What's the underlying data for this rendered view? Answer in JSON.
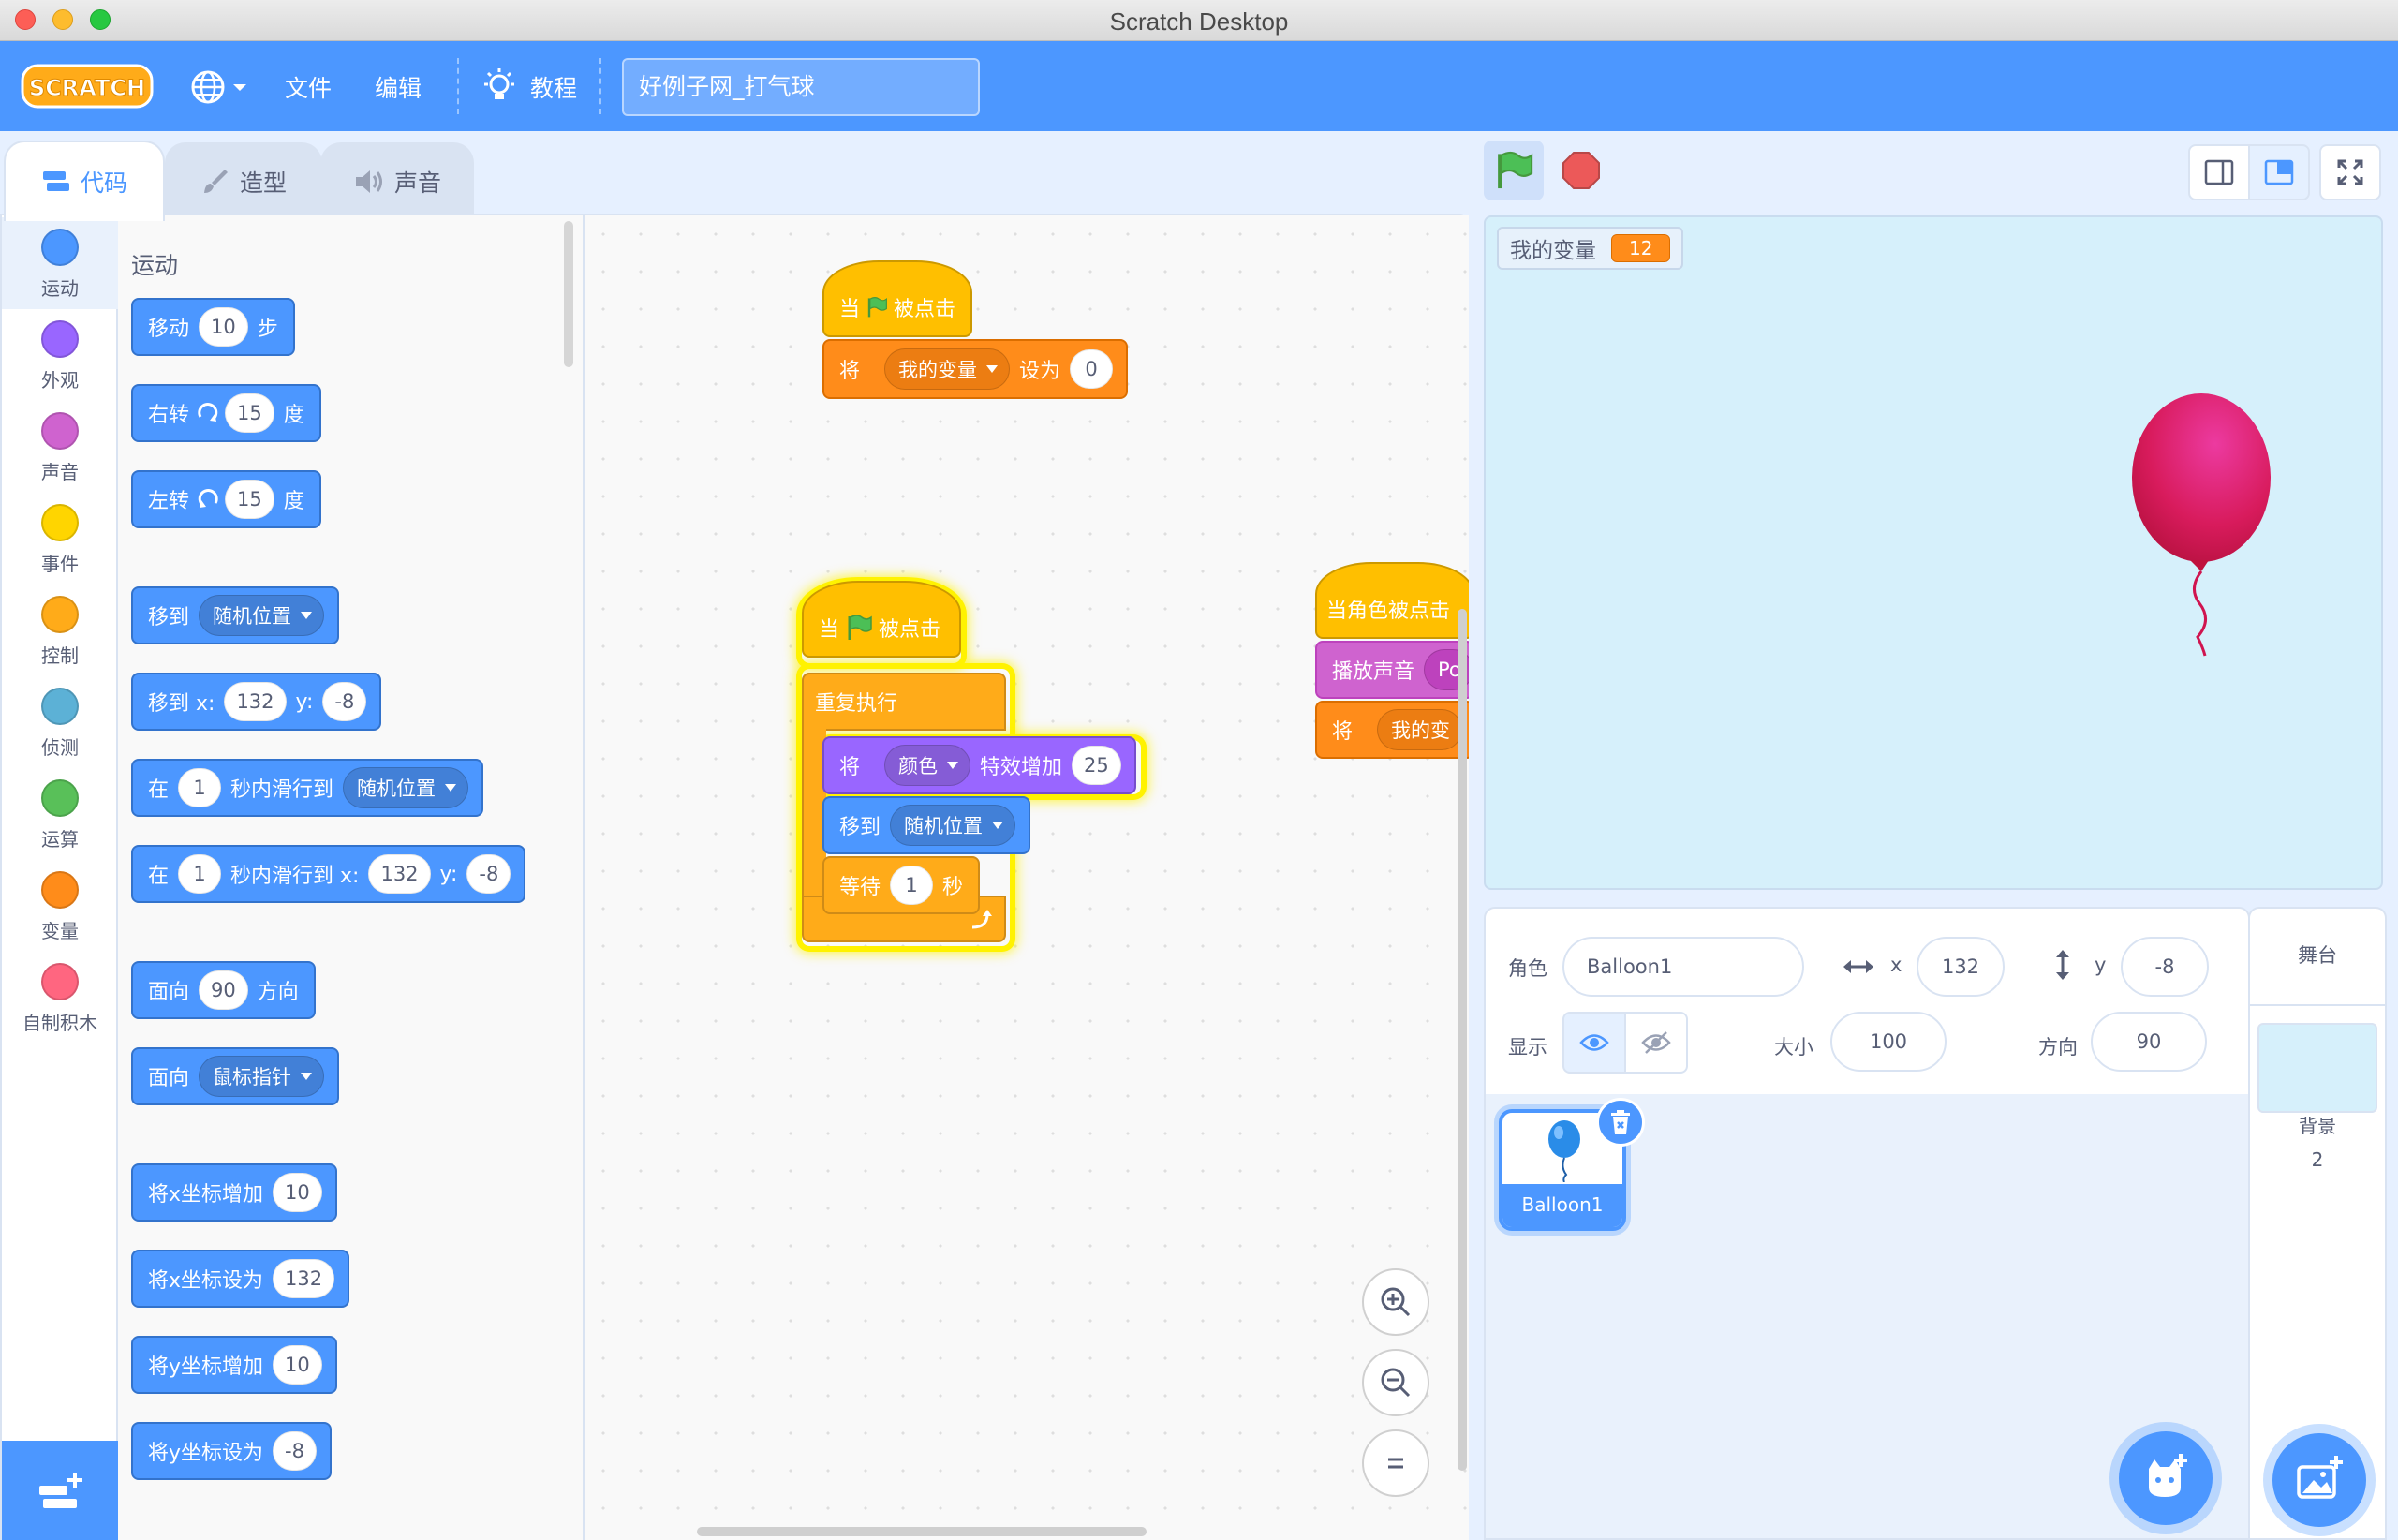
{
  "window": {
    "title": "Scratch Desktop"
  },
  "menu": {
    "logo_text": "SCRATCH",
    "file": "文件",
    "edit": "编辑",
    "tutorials": "教程",
    "project_title": "好例子网_打气球"
  },
  "tabs": {
    "code": "代码",
    "costumes": "造型",
    "sounds": "声音"
  },
  "categories": [
    {
      "label": "运动",
      "color": "#4c97ff"
    },
    {
      "label": "外观",
      "color": "#9966ff"
    },
    {
      "label": "声音",
      "color": "#cf63cf"
    },
    {
      "label": "事件",
      "color": "#ffd500"
    },
    {
      "label": "控制",
      "color": "#ffab19"
    },
    {
      "label": "侦测",
      "color": "#5cb1d6"
    },
    {
      "label": "运算",
      "color": "#59c059"
    },
    {
      "label": "变量",
      "color": "#ff8c1a"
    },
    {
      "label": "自制积木",
      "color": "#ff6680"
    }
  ],
  "palette": {
    "title": "运动",
    "move": {
      "a": "移动",
      "v": "10",
      "b": "步"
    },
    "turn_right": {
      "a": "右转",
      "v": "15",
      "b": "度"
    },
    "turn_left": {
      "a": "左转",
      "v": "15",
      "b": "度"
    },
    "goto": {
      "a": "移到",
      "dd": "随机位置"
    },
    "goto_xy": {
      "a": "移到 x:",
      "x": "132",
      "yl": "y:",
      "y": "-8"
    },
    "glide_to": {
      "a": "在",
      "v": "1",
      "b": "秒内滑行到",
      "dd": "随机位置"
    },
    "glide_xy": {
      "a": "在",
      "v": "1",
      "b": "秒内滑行到 x:",
      "x": "132",
      "yl": "y:",
      "y": "-8"
    },
    "point_dir": {
      "a": "面向",
      "v": "90",
      "b": "方向"
    },
    "point_towards": {
      "a": "面向",
      "dd": "鼠标指针"
    },
    "change_x": {
      "a": "将x坐标增加",
      "v": "10"
    },
    "set_x": {
      "a": "将x坐标设为",
      "v": "132"
    },
    "change_y": {
      "a": "将y坐标增加",
      "v": "10"
    },
    "set_y": {
      "a": "将y坐标设为",
      "v": "-8"
    }
  },
  "script1": {
    "hat_a": "当",
    "hat_b": "被点击",
    "set_a": "将",
    "set_dd": "我的变量",
    "set_b": "设为",
    "set_v": "0"
  },
  "script2": {
    "hat_a": "当",
    "hat_b": "被点击",
    "forever": "重复执行",
    "effect_a": "将",
    "effect_dd": "颜色",
    "effect_b": "特效增加",
    "effect_v": "25",
    "goto_a": "移到",
    "goto_dd": "随机位置",
    "wait_a": "等待",
    "wait_v": "1",
    "wait_b": "秒"
  },
  "script3": {
    "hat": "当角色被点击",
    "sound_a": "播放声音",
    "sound_dd": "Po",
    "set_a": "将",
    "set_dd": "我的变"
  },
  "stage": {
    "monitor_label": "我的变量",
    "monitor_value": "12"
  },
  "sprite": {
    "label_sprite": "角色",
    "name": "Balloon1",
    "label_x": "x",
    "x": "132",
    "label_y": "y",
    "y": "-8",
    "label_show": "显示",
    "label_size": "大小",
    "size": "100",
    "label_direction": "方向",
    "direction": "90",
    "thumb_name": "Balloon1"
  },
  "stage_panel": {
    "title": "舞台",
    "backdrops_label": "背景",
    "backdrops_count": "2"
  }
}
